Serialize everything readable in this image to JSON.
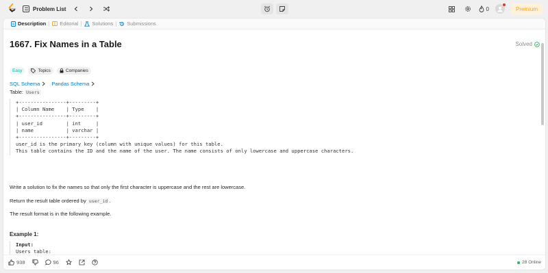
{
  "nav": {
    "problem_list_label": "Problem List",
    "streak_count": "0",
    "premium_label": "Premium"
  },
  "tabs": [
    {
      "label": "Description",
      "icon": "description-icon"
    },
    {
      "label": "Editorial",
      "icon": "editorial-icon"
    },
    {
      "label": "Solutions",
      "icon": "solutions-icon"
    },
    {
      "label": "Submissions",
      "icon": "submissions-icon"
    }
  ],
  "problem": {
    "title": "1667. Fix Names in a Table",
    "status": "Solved",
    "difficulty": "Easy",
    "tags": [
      "Topics",
      "Companies"
    ],
    "schema_links": [
      "SQL Schema",
      "Pandas Schema"
    ],
    "table_label": "Table:",
    "table_name": "Users",
    "schema_block": "+----------------+---------+\n| Column Name    | Type    |\n+----------------+---------+\n| user_id        | int     |\n| name           | varchar |\n+----------------+---------+\nuser_id is the primary key (column with unique values) for this table.\nThis table contains the ID and the name of the user. The name consists of only lowercase and uppercase characters.",
    "description": "Write a solution to fix the names so that only the first character is uppercase and the rest are lowercase.",
    "order_text_prefix": "Return the result table ordered by",
    "order_column": "user_id",
    "order_text_suffix": ".",
    "format_text": "The result format is in the following example.",
    "example_title": "Example 1:",
    "example_input_label": "Input:",
    "example_lines": "Users table:\n+---------+-------+\n| user_id | name  |"
  },
  "bottom": {
    "likes": "938",
    "comments": "96",
    "online": "28 Online"
  },
  "colors": {
    "easy": "#00b8a3",
    "accent": "#ffa116",
    "link": "#007bc4",
    "online": "#2db55d"
  }
}
